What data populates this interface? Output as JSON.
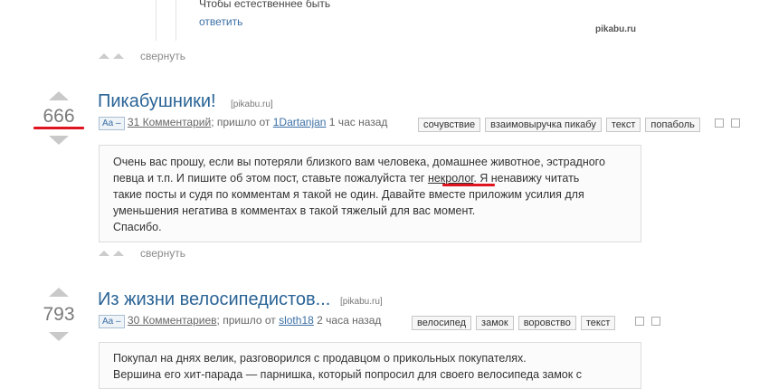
{
  "watermark": "pikabu.ru",
  "top_comment": {
    "text": "Чтобы естественнее быть",
    "reply_label": "ответить",
    "collapse_label": "свернуть"
  },
  "posts": [
    {
      "rating": "666",
      "title": "Пикабушники!",
      "source": "[pikabu.ru]",
      "font_toggle": "Aa –",
      "comments_link": "31 Комментарий",
      "meta_sep": "; пришло от ",
      "author": "1Dartanjan",
      "time": " 1 час назад",
      "tags": [
        "сочувствие",
        "взаимовыручка пикабу",
        "текст",
        "попаболь"
      ],
      "body_lines": [
        "Очень вас прошу, если вы потеряли близкого вам человека, домашнее животное, эстрадного",
        "певца и т.п. И пишите об этом пост, ставьте пожалуйста тег ",
        "некролог",
        ". Я ненавижу читать",
        "такие посты и судя по комментам я такой не один. Давайте вместе приложим усилия для",
        "уменьшения негатива в комментах в такой тяжелый для вас момент.",
        "Спасибо."
      ],
      "collapse_label": "свернуть"
    },
    {
      "rating": "793",
      "title": "Из жизни велосипедистов...",
      "source": "[pikabu.ru]",
      "font_toggle": "Aa –",
      "comments_link": "30 Комментариев",
      "meta_sep": "; пришло от ",
      "author": "sloth18",
      "time": " 2 часа назад",
      "tags": [
        "велосипед",
        "замок",
        "воровство",
        "текст"
      ],
      "body_lines": [
        "Покупал на днях велик, разговорился с продавцом о прикольных покупателях.",
        "Вершина его хит-парада — парнишка, который попросил для своего велосипеда замок с"
      ]
    }
  ],
  "colors": {
    "title": "#2a6496",
    "highlight": "#e0141e",
    "link": "#3a6fa5"
  }
}
